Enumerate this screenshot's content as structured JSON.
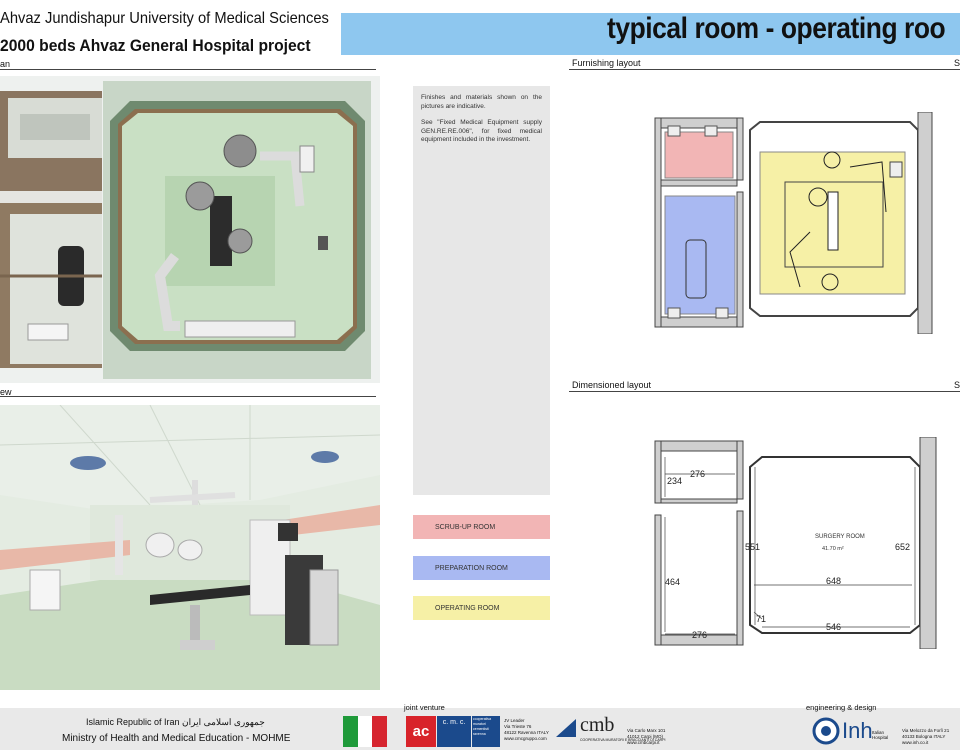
{
  "header": {
    "university": "Ahvaz Jundishapur University of Medical Sciences",
    "project": "2000 beds Ahvaz General Hospital project",
    "title": "typical room  - operating roo"
  },
  "sections": {
    "plan_label": "an",
    "view_label": "ew",
    "furnishing_label": "Furnishing layout",
    "furnishing_right": "S",
    "dimensioned_label": "Dimensioned layout",
    "dimensioned_right": "S"
  },
  "notes": {
    "line1": "Finishes and materials  shown on the pictures are indicative.",
    "line2": "See \"Fixed Medical Equipment supply GEN.RE.RE.006\", for  fixed medical equipment included in the investment."
  },
  "legend": [
    {
      "label": "SCRUB-UP ROOM",
      "color": "#f2b5b5"
    },
    {
      "label": "PREPARATION ROOM",
      "color": "#a9b9f2"
    },
    {
      "label": "OPERATING ROOM",
      "color": "#f6f0a6"
    }
  ],
  "dimensions": {
    "room_name": "SURGERY ROOM",
    "room_area": "41.70 m²",
    "d276_top": "276",
    "d234": "234",
    "d551": "551",
    "d652": "652",
    "d648": "648",
    "d464": "464",
    "d71": "71",
    "d546": "546",
    "d276_bottom": "276"
  },
  "footer": {
    "country": "Islamic Republic of Iran جمهوری اسلامی ایران",
    "ministry": "Ministry of Health and Medical Education - MOHME",
    "joint_venture": "joint venture",
    "engineering": "engineering & design",
    "cmc_name": "c. m. c.",
    "cmc_sub": "cooperativa muratori cementisti ravenna",
    "cmc_addr1": "JV Leader",
    "cmc_addr2": "Via Trieste 76",
    "cmc_addr3": "48122 Ravenna ITALY",
    "cmc_addr4": "www.cmcgruppo.com",
    "cmb_name": "cmb",
    "cmb_sub": "COOPERATIVA MURATORI E BRACCIANTI DI CARPI",
    "cmb_addr1": "Via Carlo Marx 101",
    "cmb_addr2": "41012 Carpi (MO)",
    "cmb_addr3": "www.cmbcarpi.it",
    "inh_name": "Inh",
    "inh_sub": "Italian Hospital",
    "inh_addr1": "Via Melozzo da Forlì 21",
    "inh_addr2": "40133 Bologna ITALY",
    "inh_addr3": "www.inh.co.it"
  },
  "colors": {
    "title_band": "#8ec7ef",
    "scrub": "#f2b5b5",
    "prep": "#a9b9f2",
    "operating": "#f6f0a6"
  }
}
